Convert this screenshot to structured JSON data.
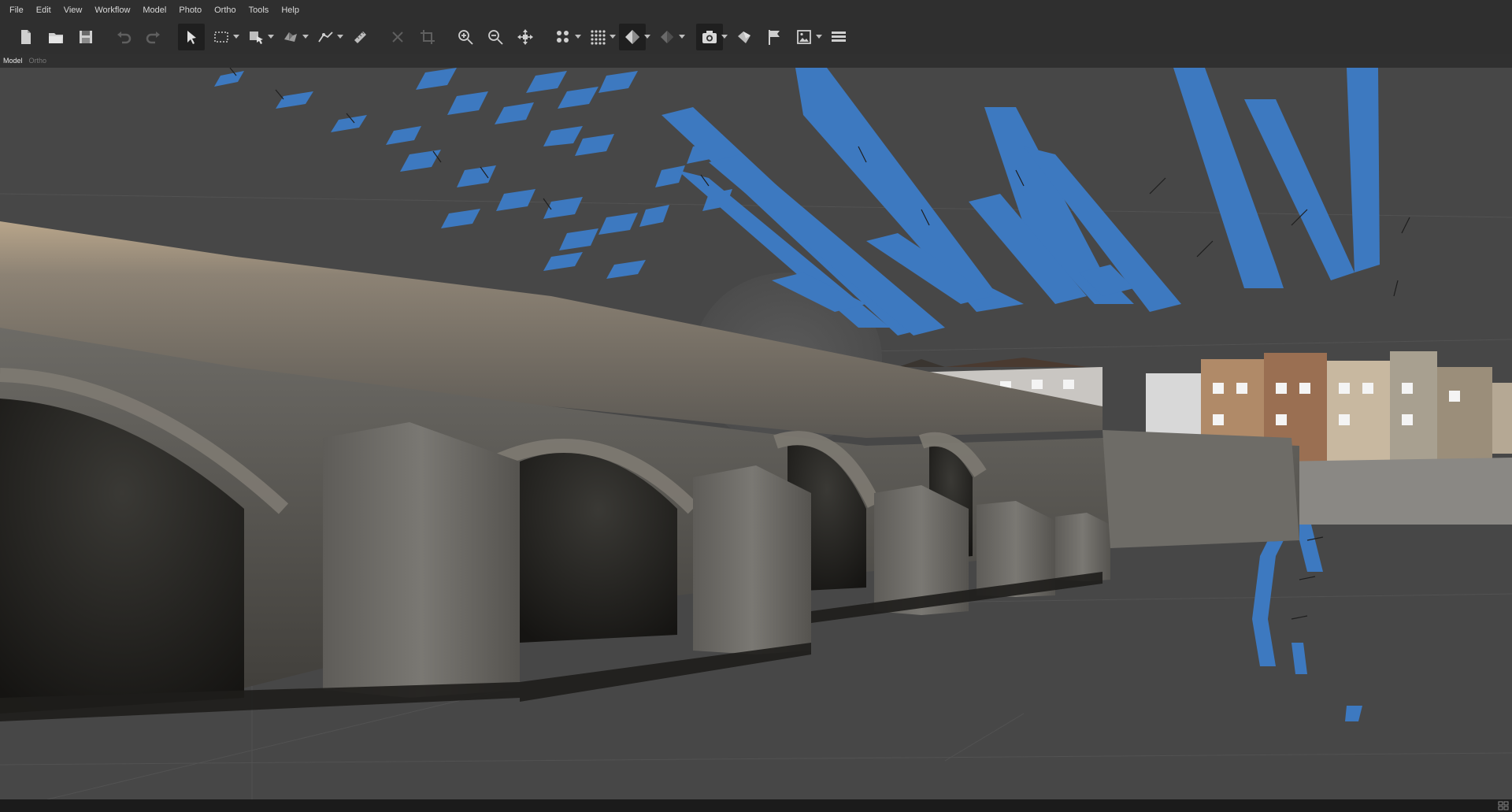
{
  "menu": {
    "items": [
      "File",
      "Edit",
      "View",
      "Workflow",
      "Model",
      "Photo",
      "Ortho",
      "Tools",
      "Help"
    ]
  },
  "toolbar": {
    "tools": [
      {
        "name": "new-icon",
        "dropdown": false
      },
      {
        "name": "open-icon",
        "dropdown": false
      },
      {
        "name": "save-icon",
        "dropdown": false
      },
      {
        "name": "undo-icon",
        "dropdown": false,
        "disabled": true
      },
      {
        "name": "redo-icon",
        "dropdown": false,
        "disabled": true
      },
      {
        "name": "navigation-pointer-icon",
        "dropdown": false,
        "active": true
      },
      {
        "name": "rectangle-selection-icon",
        "dropdown": true
      },
      {
        "name": "model-move-icon",
        "dropdown": true
      },
      {
        "name": "shape-icon",
        "dropdown": true
      },
      {
        "name": "draw-polyline-icon",
        "dropdown": true
      },
      {
        "name": "ruler-icon",
        "dropdown": false
      },
      {
        "name": "delete-selection-icon",
        "dropdown": false,
        "disabled": true
      },
      {
        "name": "crop-selection-icon",
        "dropdown": false,
        "disabled": true
      },
      {
        "name": "zoom-in-icon",
        "dropdown": false
      },
      {
        "name": "zoom-out-icon",
        "dropdown": false
      },
      {
        "name": "reset-view-icon",
        "dropdown": false
      },
      {
        "name": "point-cloud-icon",
        "dropdown": true
      },
      {
        "name": "dense-cloud-icon",
        "dropdown": true
      },
      {
        "name": "model-textured-icon",
        "dropdown": true,
        "active": true
      },
      {
        "name": "tiled-model-icon",
        "dropdown": true
      },
      {
        "name": "show-cameras-icon",
        "dropdown": true,
        "active": true
      },
      {
        "name": "show-shapes-icon",
        "dropdown": false
      },
      {
        "name": "show-markers-icon",
        "dropdown": false
      },
      {
        "name": "show-images-icon",
        "dropdown": true
      },
      {
        "name": "show-layers-icon",
        "dropdown": false
      }
    ]
  },
  "tabs": {
    "model": "Model",
    "ortho": "Ortho"
  },
  "colors": {
    "camera_blue": "#3d79c0",
    "viewport_bg": "#474747"
  }
}
